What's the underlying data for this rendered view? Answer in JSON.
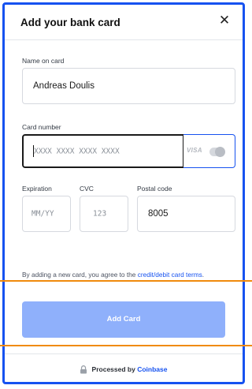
{
  "modal": {
    "title": "Add your bank card",
    "close_icon": "close-icon"
  },
  "form": {
    "name_label": "Name on card",
    "name_value": "Andreas Doulis",
    "card_label": "Card number",
    "card_placeholder": "XXXX XXXX XXXX XXXX",
    "card_brand": "VISA",
    "expiration_label": "Expiration",
    "expiration_placeholder": "MM/YY",
    "cvc_label": "CVC",
    "cvc_placeholder": "123",
    "postal_label": "Postal code",
    "postal_value": "8005"
  },
  "terms": {
    "text": "By adding a new card, you agree to the ",
    "link": "credit/debit card terms",
    "end": "."
  },
  "actions": {
    "add_label": "Add Card"
  },
  "footer": {
    "prefix": "Processed by ",
    "brand": "Coinbase"
  },
  "colors": {
    "accent": "#1652f0",
    "button_disabled": "#8fb0fb",
    "highlight_line": "#f08a0c"
  }
}
